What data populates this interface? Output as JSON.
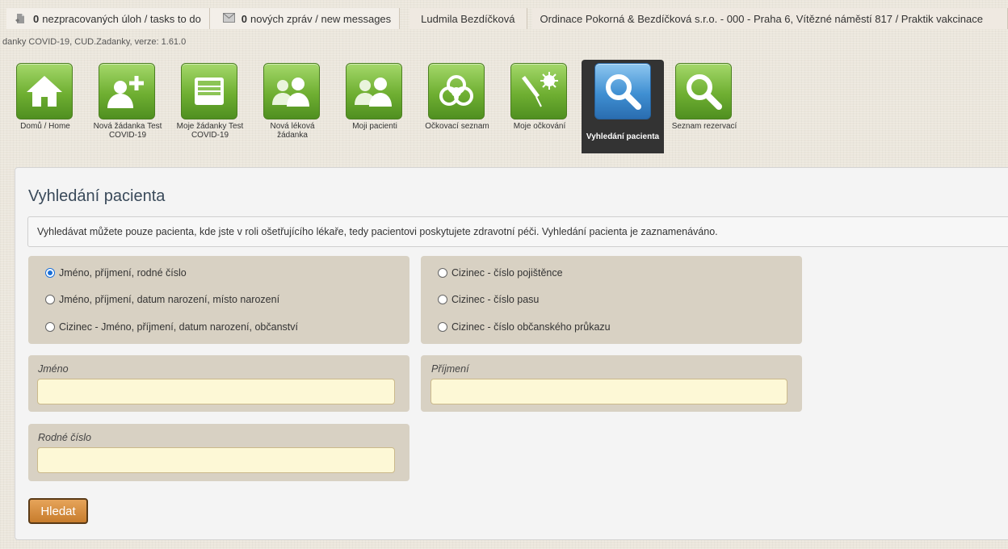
{
  "topbar": {
    "tasks_count": "0",
    "tasks_text": "nezpracovaných úloh / tasks to do",
    "messages_count": "0",
    "messages_text": "nových zpráv / new messages",
    "user": "Ludmila Bezdíčková",
    "organization": "Ordinace Pokorná & Bezdíčková s.r.o. - 000 - Praha 6, Vítězné náměstí 817 / Praktik vakcinace"
  },
  "version": "danky COVID-19, CUD.Zadanky, verze: 1.61.0",
  "nav": [
    {
      "label": "Domů / Home"
    },
    {
      "label": "Nová žádanka Test COVID-19"
    },
    {
      "label": "Moje žádanky Test COVID-19"
    },
    {
      "label": "Nová léková žádanka"
    },
    {
      "label": "Moji pacienti"
    },
    {
      "label": "Očkovací seznam"
    },
    {
      "label": "Moje očkování"
    },
    {
      "label": "Vyhledání pacienta"
    },
    {
      "label": "Seznam rezervací"
    }
  ],
  "page": {
    "title": "Vyhledání pacienta",
    "info": "Vyhledávat můžete pouze pacienta, kde jste v roli ošetřujícího lékaře, tedy pacientovi poskytujete zdravotní péči. Vyhledání pacienta je zaznamenáváno."
  },
  "search_options": [
    {
      "label": "Jméno, příjmení, rodné číslo",
      "selected": true
    },
    {
      "label": "Jméno, příjmení, datum narození, místo narození",
      "selected": false
    },
    {
      "label": "Cizinec - Jméno, příjmení, datum narození, občanství",
      "selected": false
    },
    {
      "label": "Cizinec - číslo pojištěnce",
      "selected": false
    },
    {
      "label": "Cizinec - číslo pasu",
      "selected": false
    },
    {
      "label": "Cizinec - číslo občanského průkazu",
      "selected": false
    }
  ],
  "form": {
    "first_name_label": "Jméno",
    "first_name_value": "",
    "last_name_label": "Příjmení",
    "last_name_value": "",
    "birth_number_label": "Rodné číslo",
    "birth_number_value": "",
    "submit_label": "Hledat"
  },
  "colors": {
    "accent_green": "#6faf32",
    "active_blue": "#3f8fd2",
    "form_box": "#d8d1c3",
    "input_bg": "#fdf8d6",
    "button": "#c77c2c"
  }
}
